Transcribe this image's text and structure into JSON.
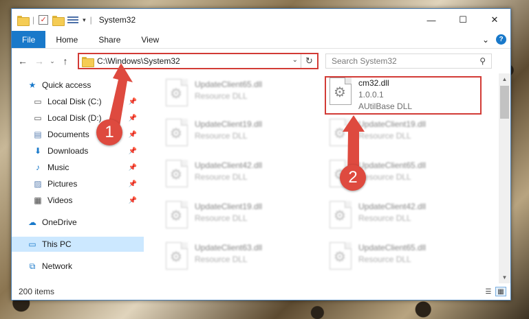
{
  "window": {
    "title": "System32",
    "controls": {
      "minimize": "—",
      "maximize": "☐",
      "close": "✕"
    }
  },
  "quick_access_toolbar": {
    "separator": "|",
    "check_glyph": "✓",
    "dropdown_glyph": "▾"
  },
  "ribbon": {
    "tabs": [
      "File",
      "Home",
      "Share",
      "View"
    ],
    "expand_glyph": "⌄",
    "help_glyph": "?"
  },
  "navigation": {
    "back_glyph": "←",
    "forward_glyph": "→",
    "recent_glyph": "⌄",
    "up_glyph": "↑",
    "address_path": "C:\\Windows\\System32",
    "address_dropdown_glyph": "⌄",
    "refresh_glyph": "↻",
    "search_placeholder": "Search System32",
    "search_glyph": "⚲"
  },
  "sidebar": {
    "pin_glyph": "📌",
    "items": [
      {
        "label": "Quick access",
        "icon": "star-icon",
        "glyph": "★",
        "color": "#1979ca"
      },
      {
        "label": "Local Disk (C:)",
        "icon": "drive-icon",
        "glyph": "▭",
        "color": "#555555"
      },
      {
        "label": "Local Disk (D:)",
        "icon": "drive-icon",
        "glyph": "▭",
        "color": "#555555"
      },
      {
        "label": "Documents",
        "icon": "documents-icon",
        "glyph": "▤",
        "color": "#5a7fb0"
      },
      {
        "label": "Downloads",
        "icon": "download-icon",
        "glyph": "⬇",
        "color": "#1979ca"
      },
      {
        "label": "Music",
        "icon": "music-icon",
        "glyph": "♪",
        "color": "#1979ca"
      },
      {
        "label": "Pictures",
        "icon": "pictures-icon",
        "glyph": "▨",
        "color": "#5a7fb0"
      },
      {
        "label": "Videos",
        "icon": "video-icon",
        "glyph": "▦",
        "color": "#444444"
      },
      {
        "label": "OneDrive",
        "icon": "cloud-icon",
        "glyph": "☁",
        "color": "#1979ca"
      },
      {
        "label": "This PC",
        "icon": "computer-icon",
        "glyph": "▭",
        "color": "#1979ca"
      },
      {
        "label": "Network",
        "icon": "network-icon",
        "glyph": "⧉",
        "color": "#1979ca"
      }
    ]
  },
  "files": {
    "gear_glyph": "⚙",
    "left_column": [
      {
        "name": "UpdateClient65.dll",
        "type": "Resource DLL"
      },
      {
        "name": "UpdateClient19.dll",
        "type": "Resource DLL"
      },
      {
        "name": "UpdateClient42.dll",
        "type": "Resource DLL"
      },
      {
        "name": "UpdateClient19.dll",
        "type": "Resource DLL"
      },
      {
        "name": "UpdateClient63.dll",
        "type": "Resource DLL"
      }
    ],
    "right_column": [
      {
        "name": "cm32.dll",
        "version": "1.0.0.1",
        "type": "AUtilBase DLL"
      },
      {
        "name": "UpdateClient19.dll",
        "type": "Resource DLL"
      },
      {
        "name": "UpdateClient65.dll",
        "type": "Resource DLL"
      },
      {
        "name": "UpdateClient42.dll",
        "type": "Resource DLL"
      },
      {
        "name": "UpdateClient65.dll",
        "type": "Resource DLL"
      }
    ]
  },
  "scrollbar": {
    "up_glyph": "▲",
    "down_glyph": "▼"
  },
  "status": {
    "item_count": "200 items",
    "details_glyph": "☰",
    "tiles_glyph": "▦"
  },
  "annotations": {
    "step1": "1",
    "step2": "2",
    "color": "#de4a3f"
  }
}
